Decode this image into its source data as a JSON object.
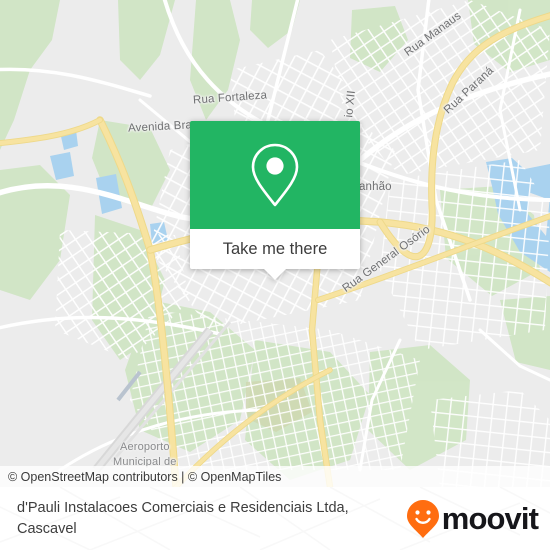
{
  "map": {
    "attribution": "© OpenStreetMap contributors | © OpenMapTiles",
    "labels": [
      {
        "id": "rua-fortaleza",
        "text": "Rua Fortaleza"
      },
      {
        "id": "avenida-brasil",
        "text": "Avenida Bra"
      },
      {
        "id": "rua-manaus",
        "text": "Rua Manaus"
      },
      {
        "id": "rua-parana",
        "text": "Rua Paraná"
      },
      {
        "id": "rua-pio-xii",
        "text": "io XII"
      },
      {
        "id": "rua-maranhao",
        "text": "anhão"
      },
      {
        "id": "rua-general-osorio",
        "text": "Rua General Osório"
      },
      {
        "id": "aeroporto-line-1",
        "text": "Aeroporto"
      },
      {
        "id": "aeroporto-line-2",
        "text": "Municipal de"
      }
    ],
    "colors": {
      "land": "#ececec",
      "park": "#cfe5c3",
      "water": "#a9d2ef",
      "road_primary": "#f7df97",
      "road_street": "#ffffff"
    }
  },
  "popup": {
    "marker_icon": "map-pin-icon",
    "button_label": "Take me there",
    "accent_color": "#22b563"
  },
  "footer": {
    "title": "d'Pauli Instalacoes Comerciais e Residenciais Ltda, Cascavel",
    "brand_name": "moovit",
    "brand_icon": "moovit-smiley-pin-icon",
    "brand_color": "#ff6d10"
  }
}
